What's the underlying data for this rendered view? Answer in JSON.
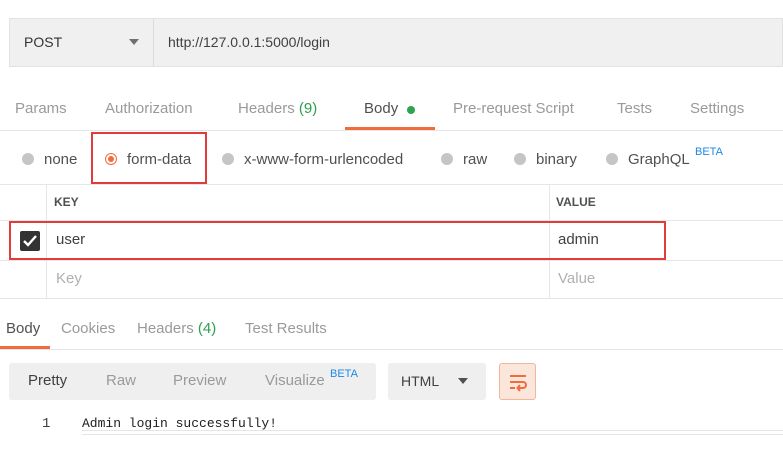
{
  "request": {
    "method": "POST",
    "url": "http://127.0.0.1:5000/login"
  },
  "request_tabs": {
    "params": "Params",
    "authorization": "Authorization",
    "headers_label": "Headers",
    "headers_count": "(9)",
    "body": "Body",
    "pre_request": "Pre-request Script",
    "tests": "Tests",
    "settings": "Settings",
    "active": "Body"
  },
  "body_types": {
    "none": "none",
    "form_data": "form-data",
    "urlencoded": "x-www-form-urlencoded",
    "raw": "raw",
    "binary": "binary",
    "graphql": "GraphQL",
    "graphql_badge": "BETA",
    "selected": "form-data"
  },
  "kv_table": {
    "key_header": "KEY",
    "value_header": "VALUE",
    "rows": [
      {
        "checked": true,
        "key": "user",
        "value": "admin"
      }
    ],
    "key_placeholder": "Key",
    "value_placeholder": "Value"
  },
  "response_tabs": {
    "body": "Body",
    "cookies": "Cookies",
    "headers_label": "Headers",
    "headers_count": "(4)",
    "test_results": "Test Results",
    "active": "Body"
  },
  "response_view": {
    "pretty": "Pretty",
    "raw": "Raw",
    "preview": "Preview",
    "visualize": "Visualize",
    "visualize_badge": "BETA",
    "format": "HTML",
    "active": "Pretty"
  },
  "response_body": {
    "lines": [
      {
        "number": "1",
        "text": "Admin login successfully!"
      }
    ]
  },
  "colors": {
    "accent": "#f26b3a",
    "count_green": "#2e9d50",
    "highlight_red": "#e03c3c",
    "beta_blue": "#1e88e5"
  }
}
